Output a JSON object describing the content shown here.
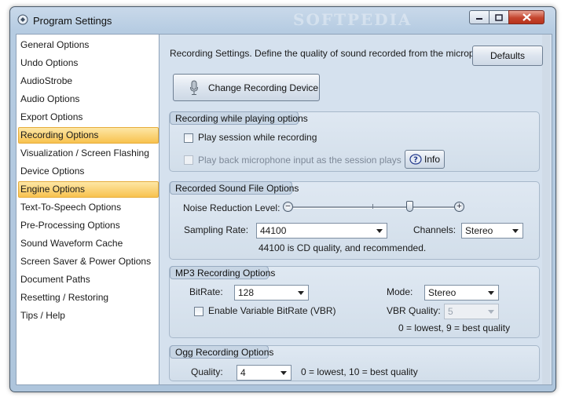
{
  "window": {
    "title": "Program Settings",
    "watermark": "SOFTPEDIA"
  },
  "nav": {
    "items": [
      {
        "label": "General Options"
      },
      {
        "label": "Undo Options"
      },
      {
        "label": "AudioStrobe"
      },
      {
        "label": "Audio Options"
      },
      {
        "label": "Export Options"
      },
      {
        "label": "Recording Options",
        "state": "selected"
      },
      {
        "label": "Visualization / Screen Flashing"
      },
      {
        "label": "Device Options"
      },
      {
        "label": "Engine Options",
        "state": "highlighted"
      },
      {
        "label": "Text-To-Speech Options"
      },
      {
        "label": "Pre-Processing Options"
      },
      {
        "label": "Sound Waveform Cache"
      },
      {
        "label": "Screen Saver & Power Options"
      },
      {
        "label": "Document Paths"
      },
      {
        "label": "Resetting / Restoring"
      },
      {
        "label": "Tips / Help"
      }
    ]
  },
  "content": {
    "description": "Recording Settings. Define the quality of sound recorded from the microphone.",
    "defaults_label": "Defaults",
    "change_device_label": "Change Recording Device",
    "playing": {
      "title": "Recording while playing options",
      "play_session_label": "Play session while recording",
      "play_session_checked": false,
      "playback_mic_label": "Play back microphone input as the session plays",
      "playback_mic_checked": false,
      "playback_mic_enabled": false,
      "info_label": "Info"
    },
    "file": {
      "title": "Recorded Sound File Options",
      "noise_label": "Noise Reduction Level:",
      "sampling_label": "Sampling Rate:",
      "sampling_value": "44100",
      "channels_label": "Channels:",
      "channels_value": "Stereo",
      "sampling_note": "44100 is CD quality, and recommended."
    },
    "mp3": {
      "title": "MP3 Recording Options",
      "bitrate_label": "BitRate:",
      "bitrate_value": "128",
      "mode_label": "Mode:",
      "mode_value": "Stereo",
      "vbr_label": "Enable Variable BitRate (VBR)",
      "vbr_checked": false,
      "vbr_quality_label": "VBR Quality:",
      "vbr_quality_value": "5",
      "vbr_note": "0 = lowest, 9 = best quality"
    },
    "ogg": {
      "title": "Ogg Recording Options",
      "quality_label": "Quality:",
      "quality_value": "4",
      "quality_note": "0 = lowest, 10 = best quality"
    }
  },
  "colors": {
    "selected_bg": "#f8c24f",
    "pane_bg": "#d5e1ee",
    "title_bar": "#b6cce2"
  },
  "icons": [
    "app-icon",
    "minimize-icon",
    "maximize-icon",
    "close-icon",
    "microphone-icon",
    "help-icon",
    "slider-minus-icon",
    "slider-plus-icon",
    "chevron-down-icon"
  ]
}
